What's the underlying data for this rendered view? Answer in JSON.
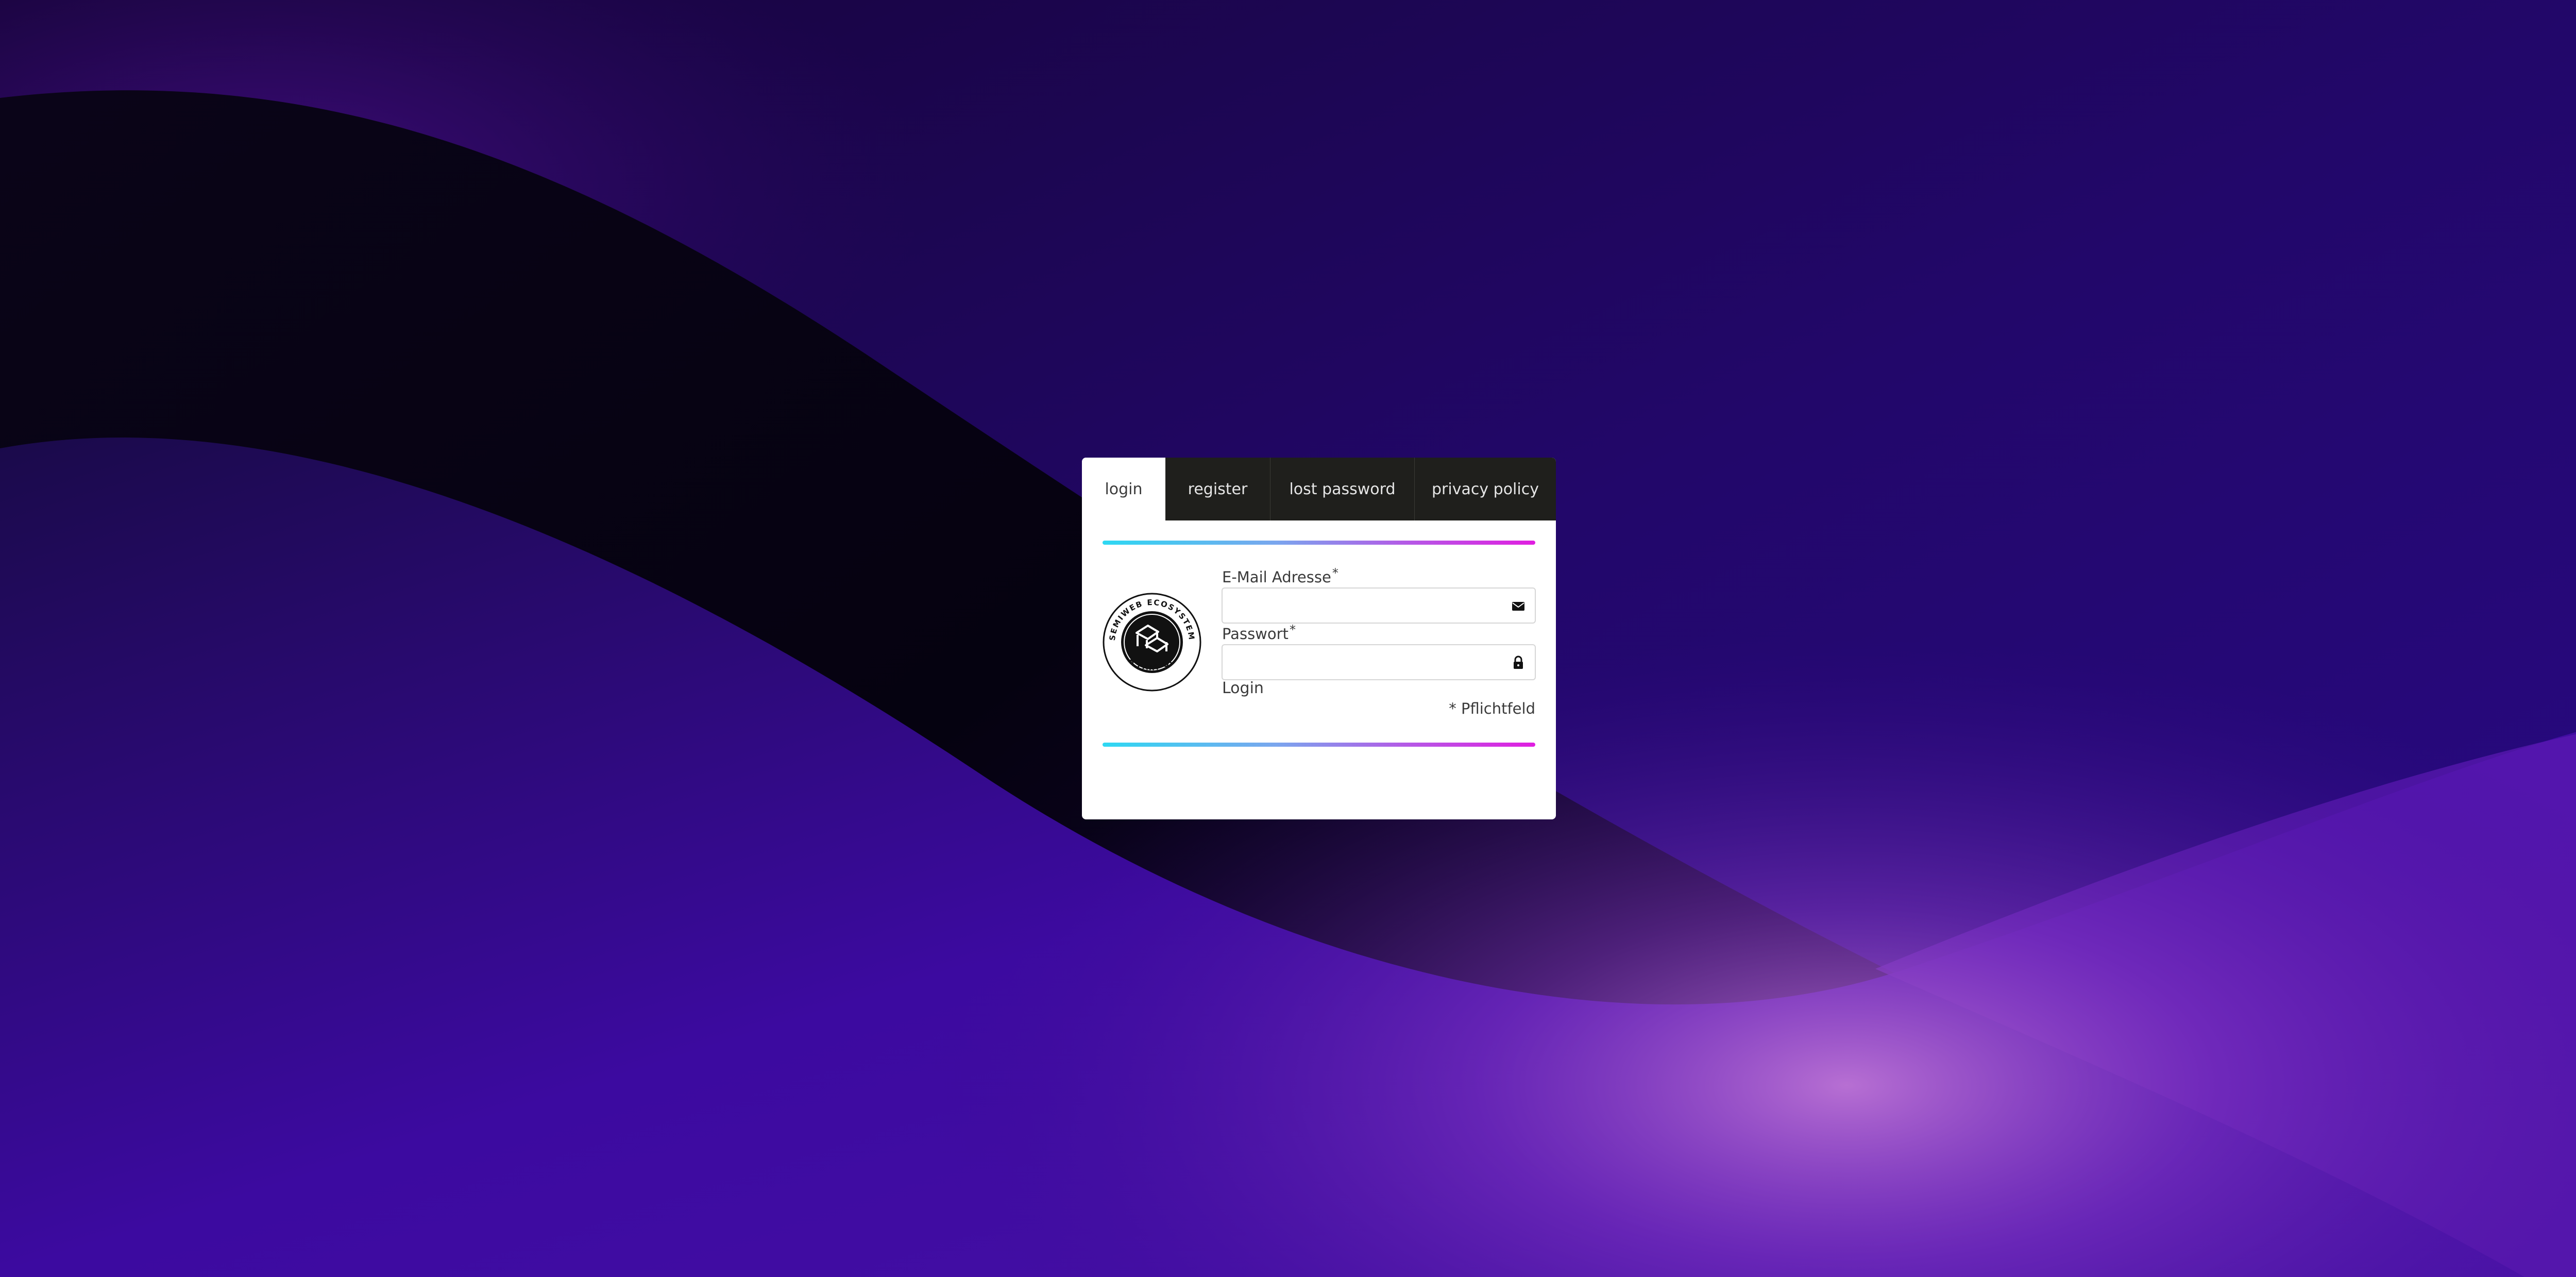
{
  "tabs": [
    {
      "label": "login",
      "active": true
    },
    {
      "label": "register",
      "active": false
    },
    {
      "label": "lost password",
      "active": false
    },
    {
      "label": "privacy policy",
      "active": false
    }
  ],
  "logo": {
    "text_top": "SEMIWEB ECOSYSTEM",
    "text_bottom": "A PART OF"
  },
  "form": {
    "email_label": "E-Mail Adresse",
    "email_required": "*",
    "email_value": "",
    "email_icon": "envelope-icon",
    "password_label": "Passwort",
    "password_required": "*",
    "password_value": "",
    "password_icon": "lock-icon",
    "login_label": "Login",
    "required_note": "* Pflichtfeld"
  },
  "colors": {
    "tab_bar": "#1f1f1c",
    "gradient_start": "#2ed8f2",
    "gradient_end": "#e01ee0",
    "background": "#1f0650"
  }
}
